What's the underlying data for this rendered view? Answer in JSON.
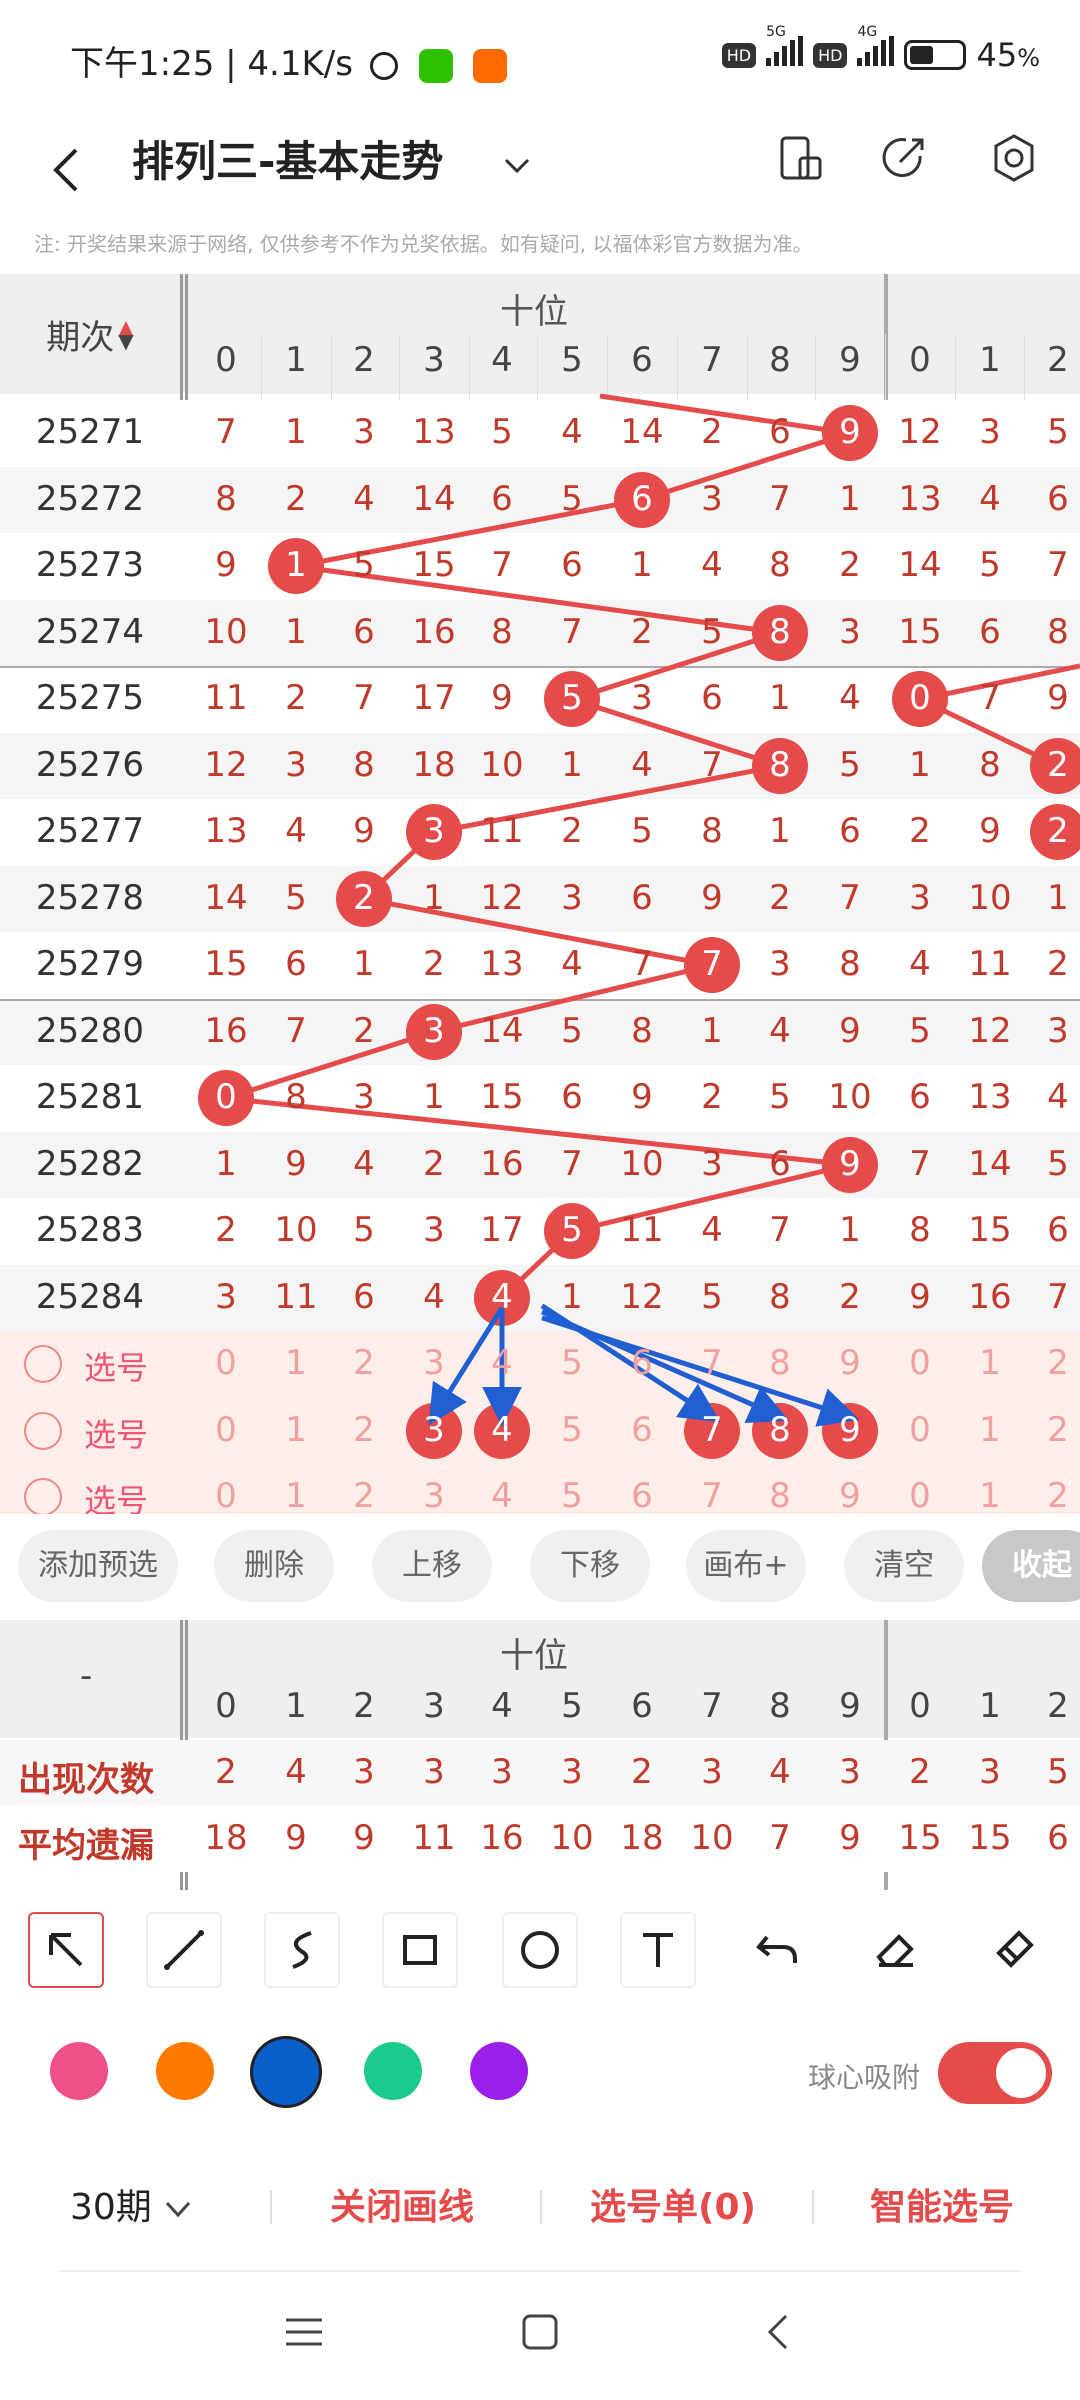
{
  "status": {
    "time": "下午1:25 | 4.1K/s",
    "battery": "45",
    "battery_unit": "%",
    "hd1": "HD",
    "hd2": "HD",
    "net1": "5G",
    "net2": "4G"
  },
  "header": {
    "title": "排列三-基本走势"
  },
  "note": "注: 开奖结果来源于网络, 仅供参考不作为兑奖依据。如有疑问, 以福体彩官方数据为准。",
  "table": {
    "period_header": "期次",
    "group_label": "十位",
    "digits": [
      "0",
      "1",
      "2",
      "3",
      "4",
      "5",
      "6",
      "7",
      "8",
      "9"
    ],
    "second_digits": [
      "0",
      "1",
      "2"
    ],
    "rows": [
      {
        "period": "25271",
        "cells": [
          "7",
          "1",
          "3",
          "13",
          "5",
          "4",
          "14",
          "2",
          "6",
          "9"
        ],
        "hit": 9,
        "second": [
          "12",
          "3",
          "5"
        ],
        "second_hit": null
      },
      {
        "period": "25272",
        "cells": [
          "8",
          "2",
          "4",
          "14",
          "6",
          "5",
          "6",
          "3",
          "7",
          "1"
        ],
        "hit": 6,
        "second": [
          "13",
          "4",
          "6"
        ],
        "second_hit": null
      },
      {
        "period": "25273",
        "cells": [
          "9",
          "1",
          "5",
          "15",
          "7",
          "6",
          "1",
          "4",
          "8",
          "2"
        ],
        "hit": 1,
        "second": [
          "14",
          "5",
          "7"
        ],
        "second_hit": null
      },
      {
        "period": "25274",
        "cells": [
          "10",
          "1",
          "6",
          "16",
          "8",
          "7",
          "2",
          "5",
          "8",
          "3"
        ],
        "hit": 8,
        "second": [
          "15",
          "6",
          "8"
        ],
        "second_hit": null
      },
      {
        "period": "25275",
        "cells": [
          "11",
          "2",
          "7",
          "17",
          "9",
          "5",
          "3",
          "6",
          "1",
          "4"
        ],
        "hit": 5,
        "second": [
          "0",
          "7",
          "9"
        ],
        "second_hit": 0
      },
      {
        "period": "25276",
        "cells": [
          "12",
          "3",
          "8",
          "18",
          "10",
          "1",
          "4",
          "7",
          "8",
          "5"
        ],
        "hit": 8,
        "second": [
          "1",
          "8",
          "2"
        ],
        "second_hit": 2
      },
      {
        "period": "25277",
        "cells": [
          "13",
          "4",
          "9",
          "3",
          "11",
          "2",
          "5",
          "8",
          "1",
          "6"
        ],
        "hit": 3,
        "second": [
          "2",
          "9",
          "2"
        ],
        "second_hit": 2
      },
      {
        "period": "25278",
        "cells": [
          "14",
          "5",
          "2",
          "1",
          "12",
          "3",
          "6",
          "9",
          "2",
          "7"
        ],
        "hit": 2,
        "second": [
          "3",
          "10",
          "1"
        ],
        "second_hit": null
      },
      {
        "period": "25279",
        "cells": [
          "15",
          "6",
          "1",
          "2",
          "13",
          "4",
          "7",
          "7",
          "3",
          "8"
        ],
        "hit": 7,
        "second": [
          "4",
          "11",
          "2"
        ],
        "second_hit": null
      },
      {
        "period": "25280",
        "cells": [
          "16",
          "7",
          "2",
          "3",
          "14",
          "5",
          "8",
          "1",
          "4",
          "9"
        ],
        "hit": 3,
        "second": [
          "5",
          "12",
          "3"
        ],
        "second_hit": null
      },
      {
        "period": "25281",
        "cells": [
          "0",
          "8",
          "3",
          "1",
          "15",
          "6",
          "9",
          "2",
          "5",
          "10"
        ],
        "hit": 0,
        "second": [
          "6",
          "13",
          "4"
        ],
        "second_hit": null
      },
      {
        "period": "25282",
        "cells": [
          "1",
          "9",
          "4",
          "2",
          "16",
          "7",
          "10",
          "3",
          "6",
          "9"
        ],
        "hit": 9,
        "second": [
          "7",
          "14",
          "5"
        ],
        "second_hit": null
      },
      {
        "period": "25283",
        "cells": [
          "2",
          "10",
          "5",
          "3",
          "17",
          "5",
          "11",
          "4",
          "7",
          "1"
        ],
        "hit": 5,
        "second": [
          "8",
          "15",
          "6"
        ],
        "second_hit": null
      },
      {
        "period": "25284",
        "cells": [
          "3",
          "11",
          "6",
          "4",
          "4",
          "1",
          "12",
          "5",
          "8",
          "2"
        ],
        "hit": 4,
        "second": [
          "9",
          "16",
          "7"
        ],
        "second_hit": null
      }
    ],
    "select_rows": [
      {
        "label": "选号",
        "selected": []
      },
      {
        "label": "选号",
        "selected": [
          3,
          4,
          7,
          8,
          9
        ]
      },
      {
        "label": "选号",
        "selected": []
      }
    ]
  },
  "toolbar": {
    "buttons": [
      "添加预选",
      "删除",
      "上移",
      "下移",
      "画布+",
      "清空"
    ],
    "collapse": "收起"
  },
  "stats": {
    "dash": "-",
    "group_label": "十位",
    "rows": [
      {
        "label": "出现次数",
        "values": [
          "2",
          "4",
          "3",
          "3",
          "3",
          "3",
          "2",
          "3",
          "4",
          "3"
        ],
        "second": [
          "2",
          "3",
          "5"
        ]
      },
      {
        "label": "平均遗漏",
        "values": [
          "18",
          "9",
          "9",
          "11",
          "16",
          "10",
          "18",
          "10",
          "7",
          "9"
        ],
        "second": [
          "15",
          "15",
          "6"
        ]
      }
    ]
  },
  "draw_tools": {
    "icons": [
      "select-arrow-icon",
      "line-icon",
      "curve-icon",
      "rectangle-icon",
      "circle-icon",
      "text-icon",
      "undo-icon",
      "eraser-icon",
      "clear-brush-icon"
    ]
  },
  "colors": {
    "swatches": [
      "#f0508a",
      "#ff7a00",
      "#0a5fc8",
      "#1ccb8b",
      "#9b1fe8"
    ],
    "accent": "#e54b4b",
    "arrow": "#1f5fd1"
  },
  "snap": {
    "label": "球心吸附",
    "on": true
  },
  "bottom": {
    "periods": "30期",
    "close_lines": "关闭画线",
    "select_list": "选号单(0)",
    "smart": "智能选号"
  }
}
